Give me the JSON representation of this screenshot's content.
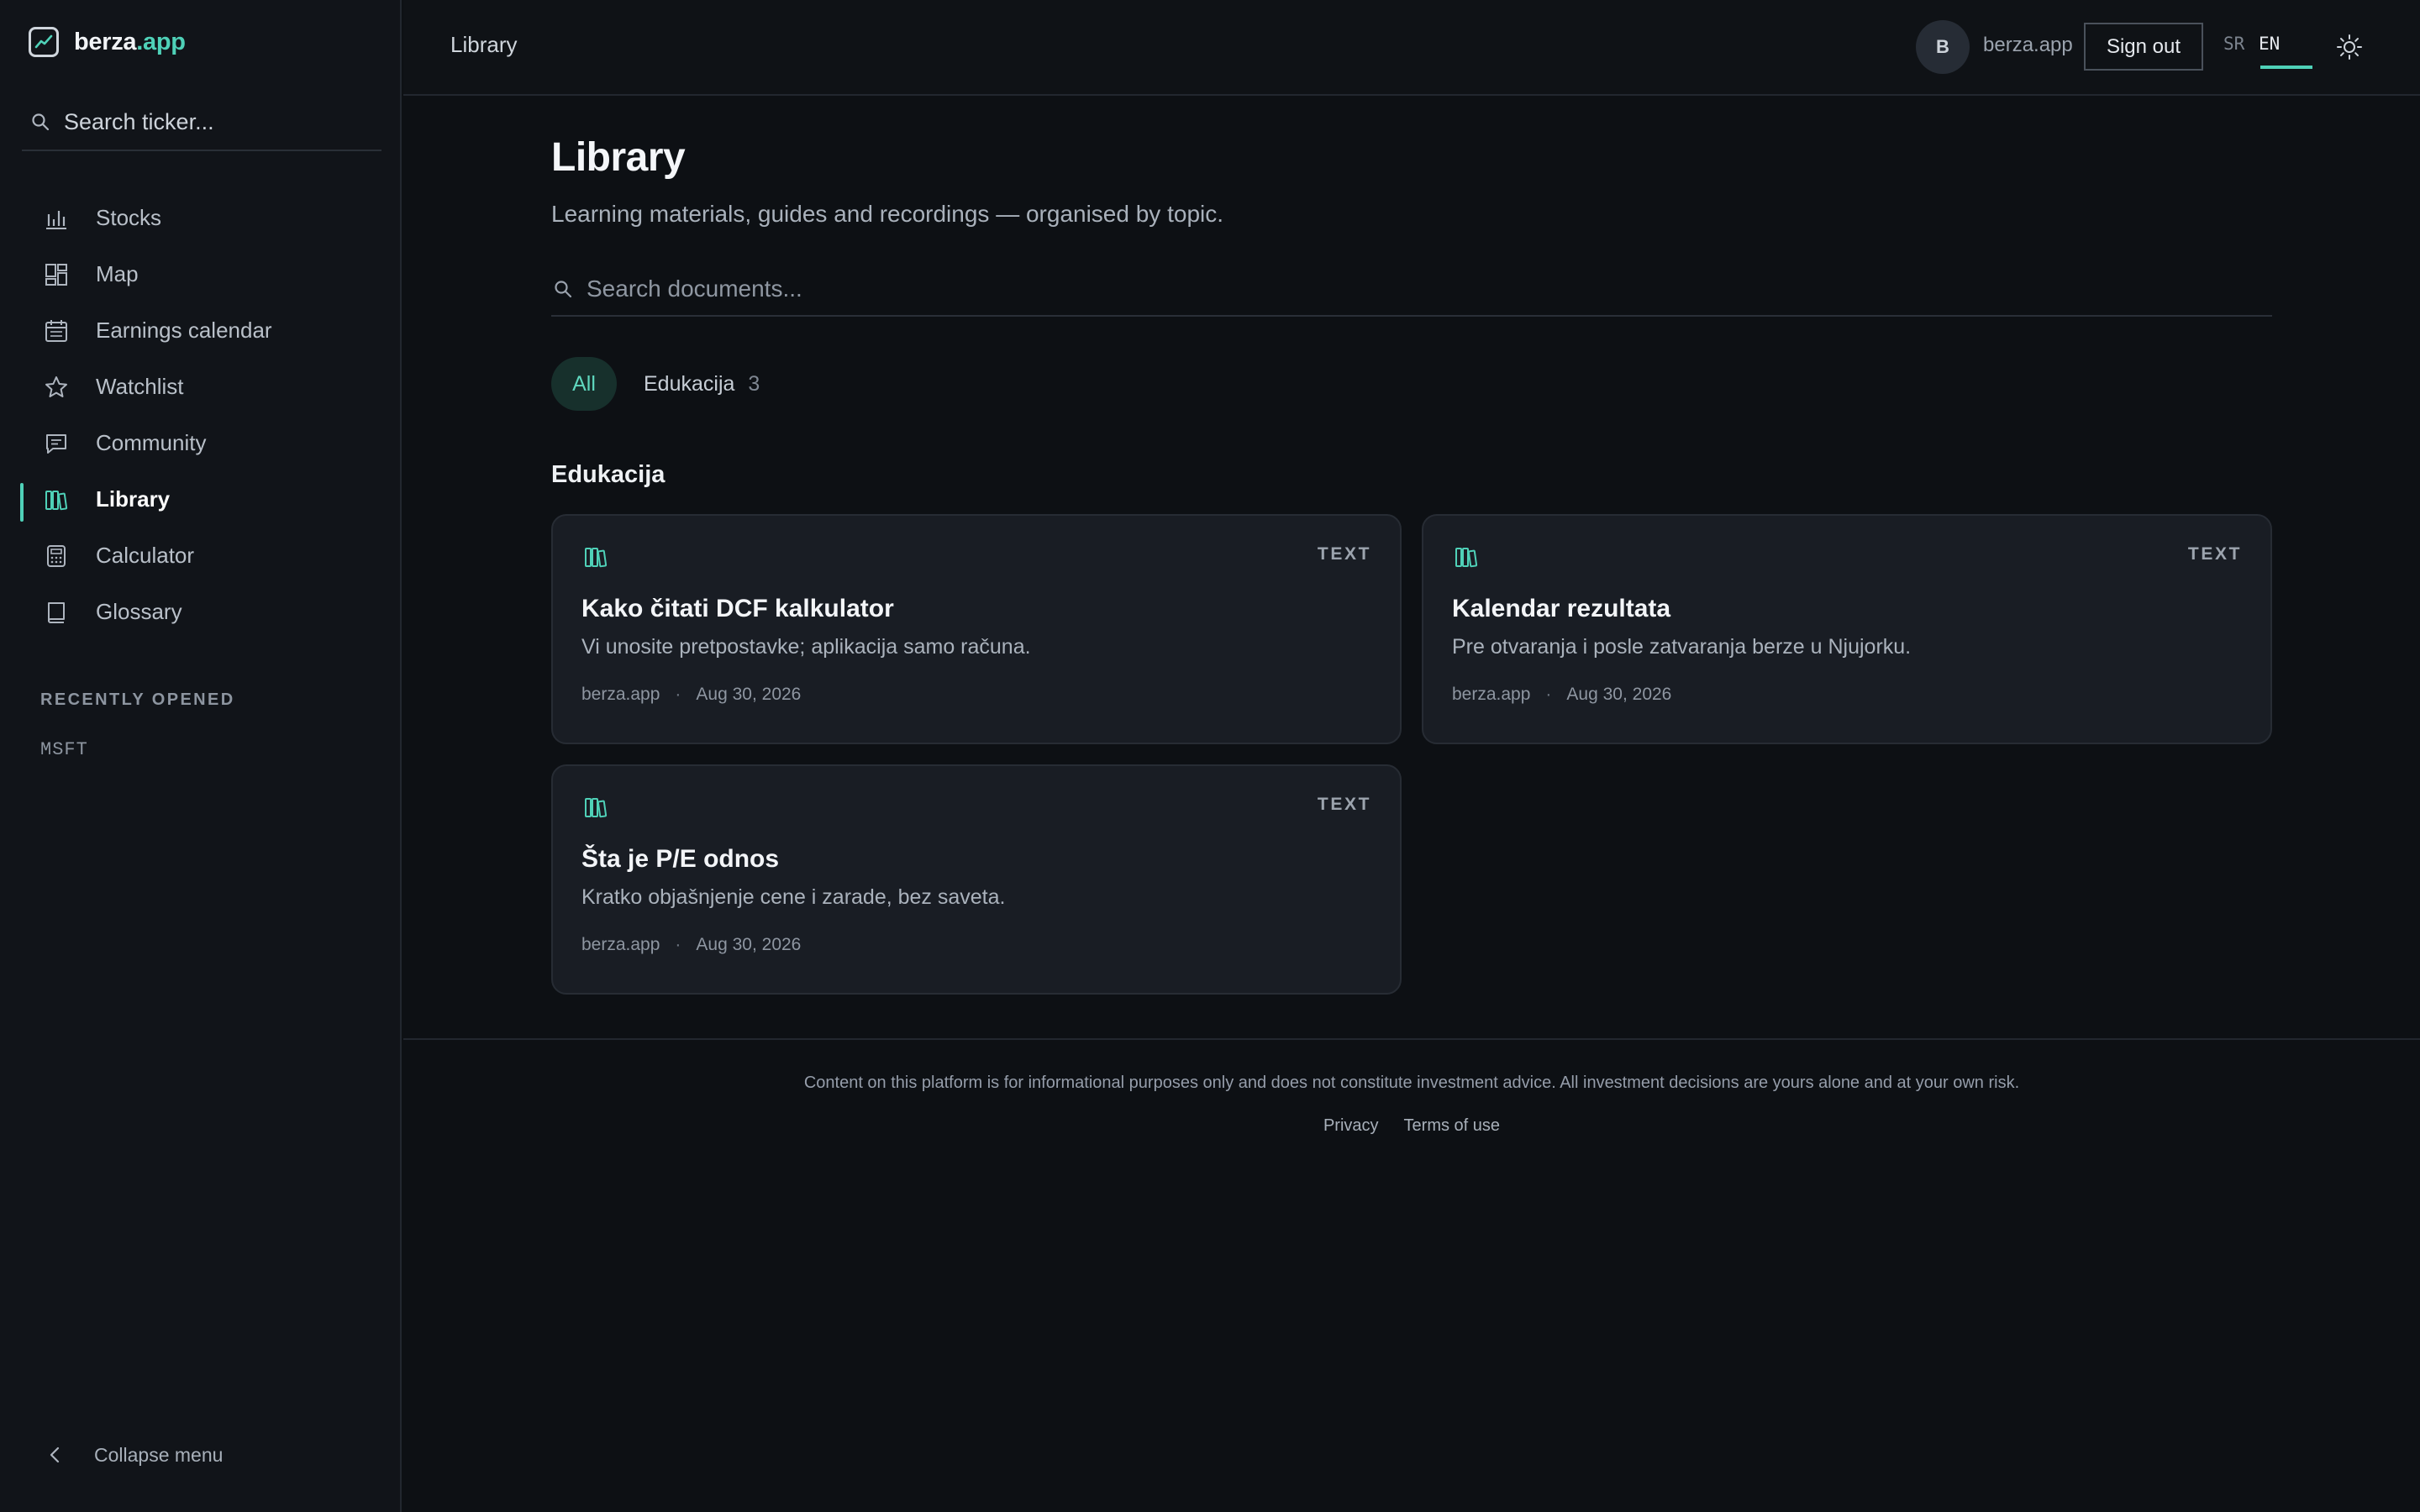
{
  "brand": {
    "name_main": "berza",
    "name_accent": ".app"
  },
  "sidebar": {
    "search_placeholder": "Search ticker...",
    "items": [
      {
        "label": "Stocks",
        "icon": "bar-chart-icon"
      },
      {
        "label": "Map",
        "icon": "grid-map-icon"
      },
      {
        "label": "Earnings calendar",
        "icon": "calendar-icon"
      },
      {
        "label": "Watchlist",
        "icon": "star-icon"
      },
      {
        "label": "Community",
        "icon": "chat-icon"
      },
      {
        "label": "Library",
        "icon": "library-icon",
        "active": true
      },
      {
        "label": "Calculator",
        "icon": "calculator-icon"
      },
      {
        "label": "Glossary",
        "icon": "book-icon"
      }
    ],
    "recent_title": "RECENTLY OPENED",
    "recent_items": [
      "MSFT"
    ],
    "collapse_label": "Collapse menu"
  },
  "topbar": {
    "title": "Library",
    "avatar_initial": "B",
    "user_name": "berza.app",
    "signout_label": "Sign out",
    "lang_sr": "SR",
    "lang_en": "EN",
    "active_lang": "EN"
  },
  "main": {
    "title": "Library",
    "subtitle": "Learning materials, guides and recordings — organised by topic.",
    "search_placeholder": "Search documents...",
    "filters": {
      "all_label": "All",
      "category_label": "Edukacija",
      "category_count": "3"
    },
    "section_title": "Edukacija",
    "cards": [
      {
        "type": "TEXT",
        "title": "Kako čitati DCF kalkulator",
        "description": "Vi unosite pretpostavke; aplikacija samo računa.",
        "author": "berza.app",
        "date": "Aug 30, 2026"
      },
      {
        "type": "TEXT",
        "title": "Kalendar rezultata",
        "description": "Pre otvaranja i posle zatvaranja berze u Njujorku.",
        "author": "berza.app",
        "date": "Aug 30, 2026"
      },
      {
        "type": "TEXT",
        "title": "Šta je P/E odnos",
        "description": "Kratko objašnjenje cene i zarade, bez saveta.",
        "author": "berza.app",
        "date": "Aug 30, 2026"
      }
    ]
  },
  "footer": {
    "disclaimer": "Content on this platform is for informational purposes only and does not constitute investment advice. All investment decisions are yours alone and at your own risk.",
    "privacy_label": "Privacy",
    "terms_label": "Terms of use"
  },
  "colors": {
    "accent": "#4fd1b8",
    "background": "#0d1014",
    "card": "#191d24"
  }
}
